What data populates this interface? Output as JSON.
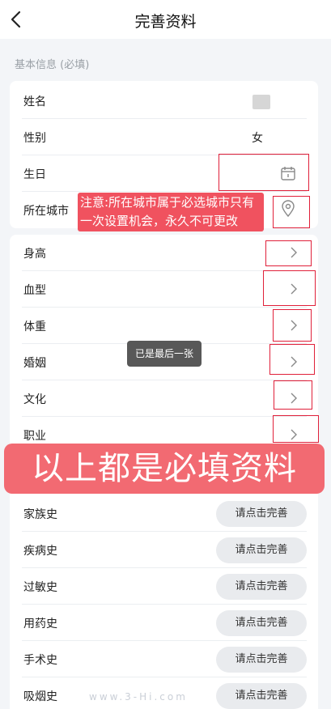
{
  "header": {
    "title": "完善资料"
  },
  "basic_section": {
    "label": "基本信息 (必填)"
  },
  "basic_fields": [
    {
      "label": "姓名",
      "value": ""
    },
    {
      "label": "性别",
      "value": "女"
    },
    {
      "label": "生日",
      "value": ""
    },
    {
      "label": "所在城市",
      "value": ""
    }
  ],
  "body_fields": [
    {
      "label": "身高"
    },
    {
      "label": "血型"
    },
    {
      "label": "体重"
    },
    {
      "label": "婚姻"
    },
    {
      "label": "文化"
    },
    {
      "label": "职业"
    }
  ],
  "history_fields": [
    {
      "label": "家族史",
      "button": "请点击完善"
    },
    {
      "label": "疾病史",
      "button": "请点击完善"
    },
    {
      "label": "过敏史",
      "button": "请点击完善"
    },
    {
      "label": "用药史",
      "button": "请点击完善"
    },
    {
      "label": "手术史",
      "button": "请点击完善"
    },
    {
      "label": "吸烟史",
      "button": "请点击完善"
    }
  ],
  "annotations": {
    "city_notice": "注意:所在城市属于必选城市只有一次设置机会，永久不可更改",
    "toast": "已是最后一张",
    "banner": "以上都是必填资料",
    "watermark": "www.3-Hi.com"
  },
  "colors": {
    "annotation_red": "#e0203a",
    "banner": "#f26a72",
    "notice": "#f0525f"
  }
}
